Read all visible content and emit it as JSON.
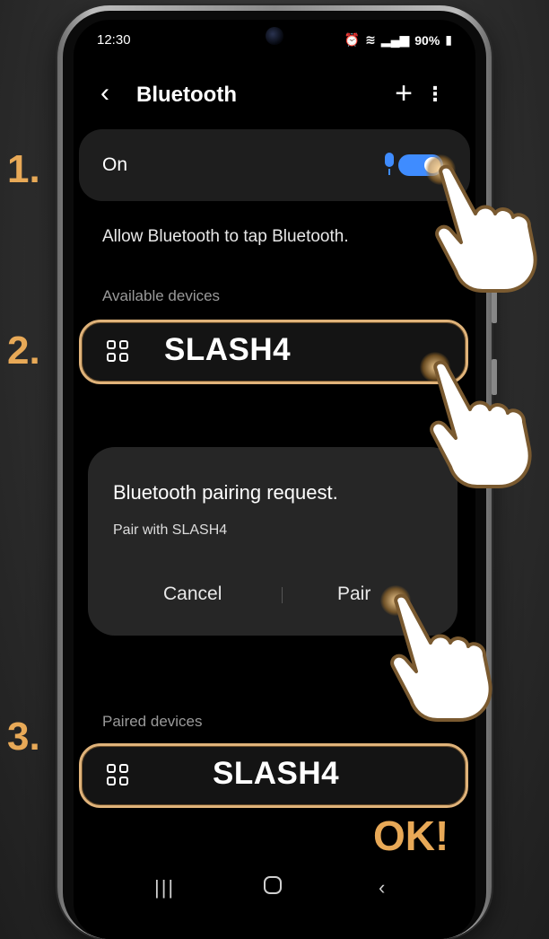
{
  "status_bar": {
    "time": "12:30",
    "battery": "90%"
  },
  "header": {
    "title": "Bluetooth"
  },
  "bluetooth_toggle": {
    "label": "On",
    "enabled": true
  },
  "allow_text": "Allow Bluetooth to tap Bluetooth.",
  "available_devices": {
    "section_label": "Available devices",
    "device_name": "SLASH4"
  },
  "pairing_dialog": {
    "title": "Bluetooth pairing request.",
    "subtitle": "Pair with SLASH4",
    "cancel_label": "Cancel",
    "pair_label": "Pair"
  },
  "paired_devices": {
    "section_label": "Paired devices",
    "device_name": "SLASH4"
  },
  "steps": {
    "step1": "1.",
    "step2": "2.",
    "step3": "3.",
    "ok": "OK!"
  },
  "colors": {
    "accent_orange": "#e8a957",
    "toggle_blue": "#3f8cff",
    "highlight_border": "#e0b37a"
  }
}
